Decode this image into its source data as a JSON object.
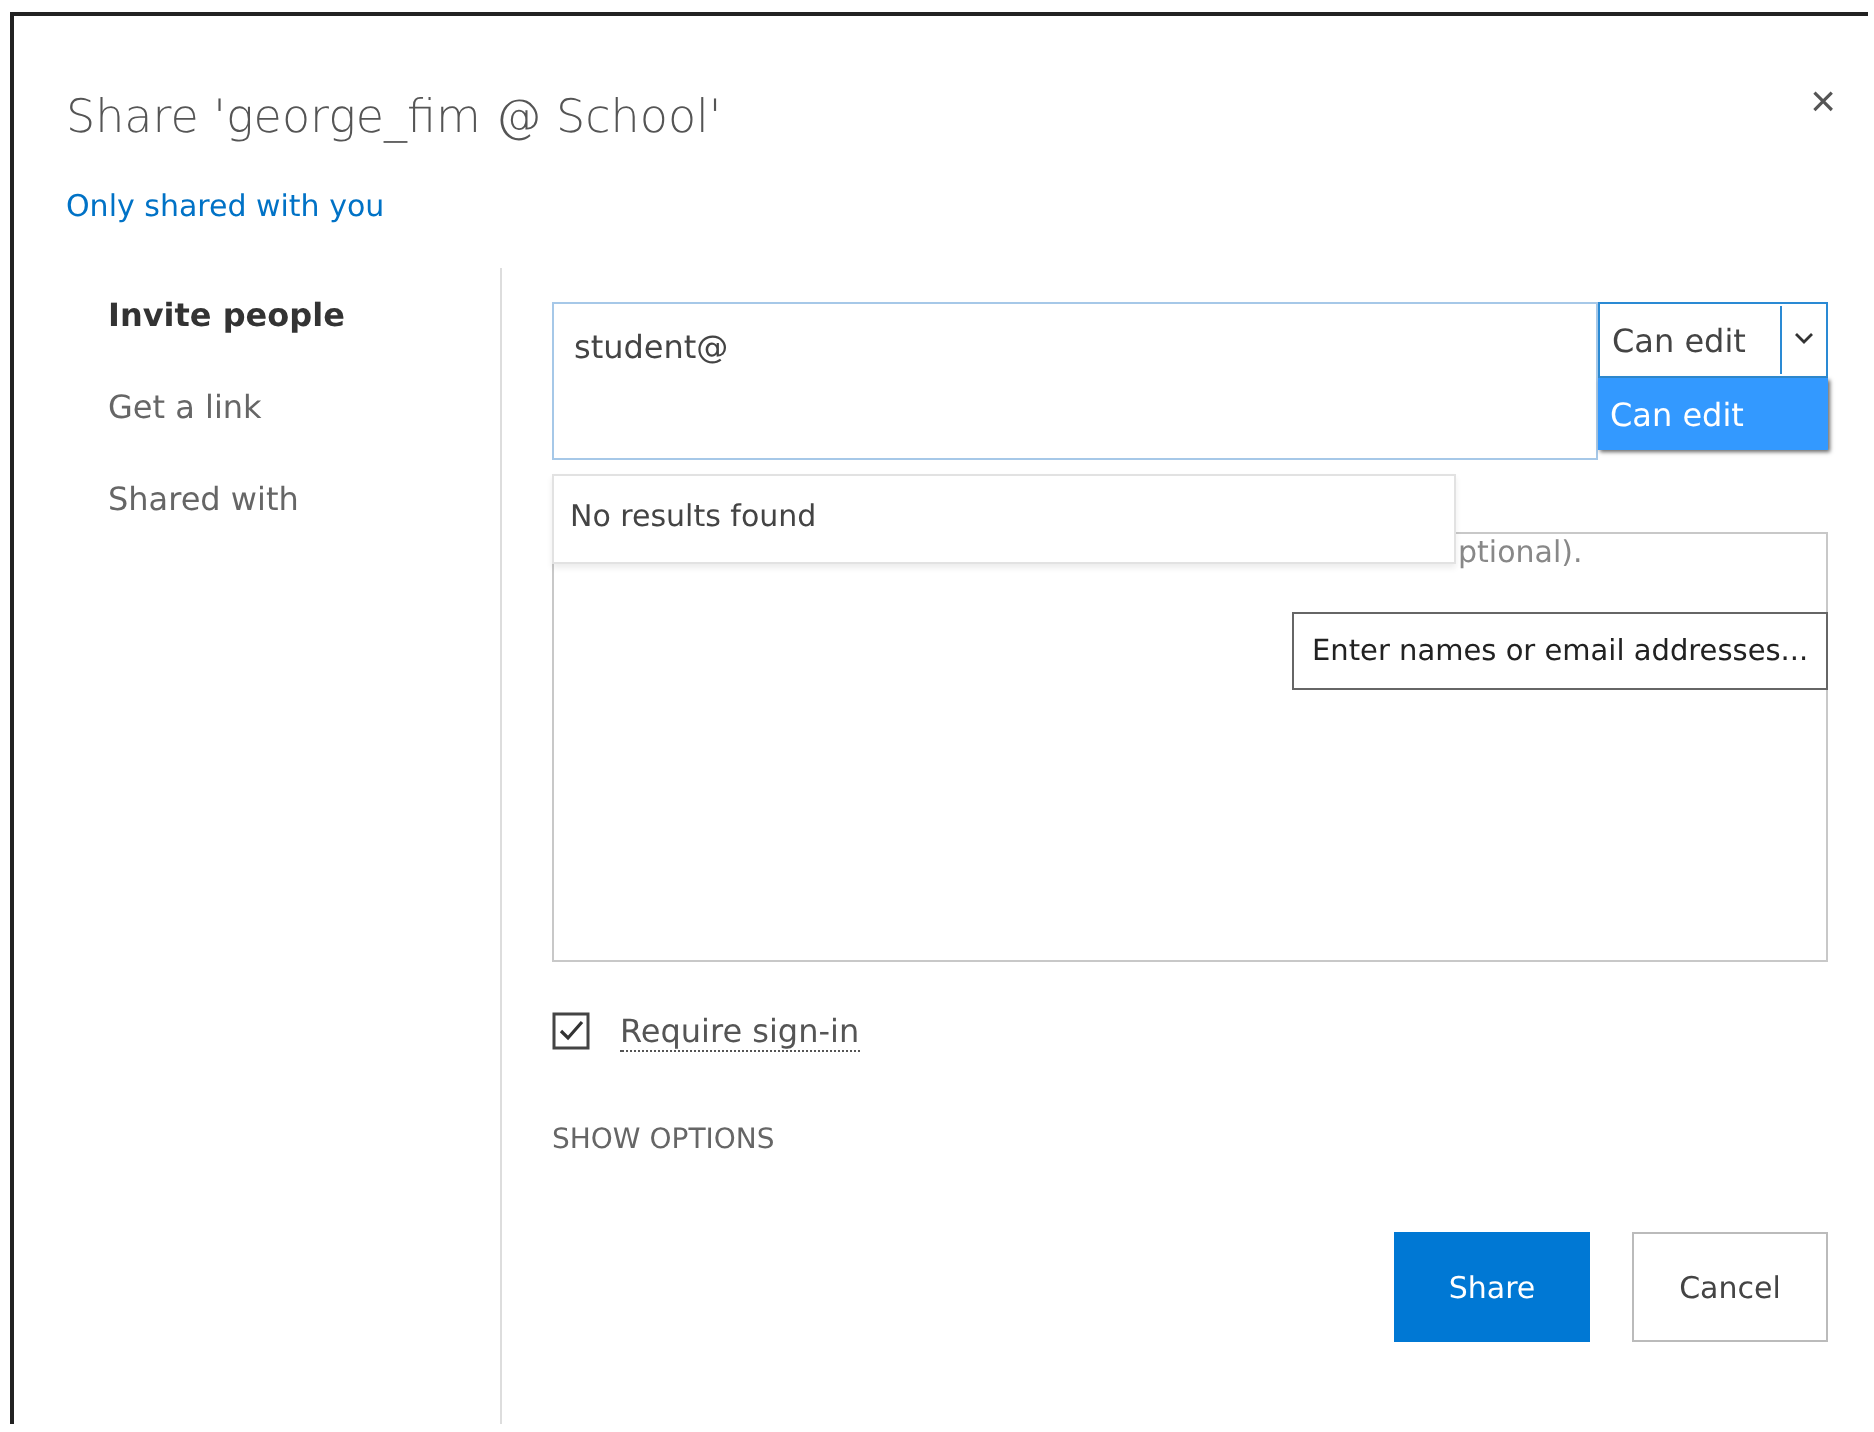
{
  "dialog": {
    "title": "Share 'george_fim @ School'",
    "close": "×",
    "sharing_status": "Only shared with you"
  },
  "nav": [
    {
      "label": "Invite people",
      "selected": true
    },
    {
      "label": "Get a link",
      "selected": false
    },
    {
      "label": "Shared with",
      "selected": false
    }
  ],
  "invite": {
    "value": "student@",
    "results_message": "No results found",
    "tooltip": "Enter names or email addresses..."
  },
  "permission": {
    "value": "Can edit",
    "options": [
      {
        "label": "Can edit",
        "selected": true
      }
    ]
  },
  "message": {
    "visible_placeholder": "ptional)."
  },
  "require_sign_in": {
    "label": "Require sign-in",
    "checked": true
  },
  "show_options": "SHOW OPTIONS",
  "buttons": [
    {
      "label": "Share",
      "kind": "primary"
    },
    {
      "label": "Cancel",
      "kind": "secondary"
    }
  ]
}
